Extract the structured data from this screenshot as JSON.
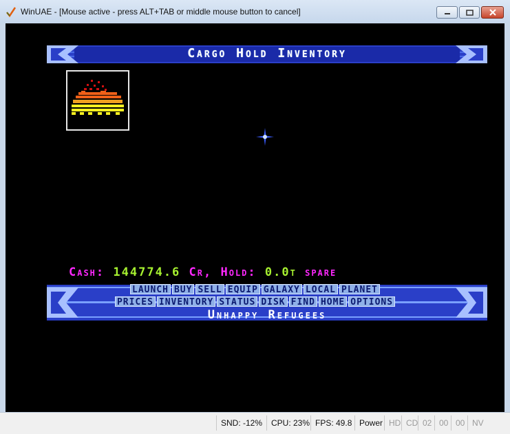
{
  "window": {
    "title": "WinUAE - [Mouse active - press ALT+TAB or middle mouse button to cancel]",
    "min_icon": "minimize-icon",
    "max_icon": "maximize-icon",
    "close_icon": "close-icon"
  },
  "game": {
    "screen_title": "Cargo Hold Inventory",
    "cash_label": "Cash:",
    "cash_value": "144774.6",
    "cash_unit": "Cr,",
    "hold_label": "Hold:",
    "hold_value": "0.0t",
    "hold_suffix": "spare",
    "commands_row1": [
      "LAUNCH",
      "BUY",
      "SELL",
      "EQUIP",
      "GALAXY",
      "LOCAL",
      "PLANET"
    ],
    "commands_row2": [
      "PRICES",
      "INVENTORY",
      "STATUS",
      "DISK",
      "FIND",
      "HOME",
      "OPTIONS"
    ],
    "status_message": "Unhappy Refugees",
    "colors": {
      "cash_label": "#ff28ff",
      "cash_value": "#a6f030",
      "banner": "#2a3fc8"
    }
  },
  "statusbar": {
    "snd": "SND: -12%",
    "cpu": "CPU: 23%",
    "fps": "FPS: 49.8",
    "power": "Power",
    "hd": "HD",
    "cd": "CD",
    "df0": "02",
    "df1": "00",
    "df2": "00",
    "nv": "NV"
  }
}
